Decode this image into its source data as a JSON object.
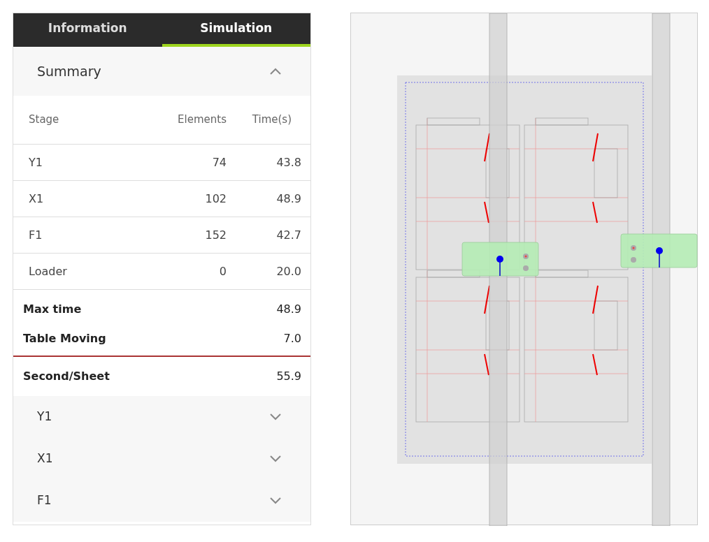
{
  "tabs": [
    {
      "label": "Information",
      "selected": false
    },
    {
      "label": "Simulation",
      "selected": true
    }
  ],
  "summary": {
    "title": "Summary",
    "expanded": true,
    "table": {
      "columns": [
        "Stage",
        "Elements",
        "Time(s)"
      ],
      "rows": [
        {
          "stage": "Y1",
          "elements": "74",
          "time": "43.8"
        },
        {
          "stage": "X1",
          "elements": "102",
          "time": "48.9"
        },
        {
          "stage": "F1",
          "elements": "152",
          "time": "42.7"
        },
        {
          "stage": "Loader",
          "elements": "0",
          "time": "20.0"
        }
      ]
    },
    "totals": [
      {
        "label": "Max time",
        "value": "48.9"
      },
      {
        "label": "Table Moving",
        "value": "7.0"
      }
    ],
    "result": {
      "label": "Second/Sheet",
      "value": "55.9"
    }
  },
  "sections": [
    {
      "title": "Y1",
      "expanded": false
    },
    {
      "title": "X1",
      "expanded": false
    },
    {
      "title": "F1",
      "expanded": false
    }
  ]
}
